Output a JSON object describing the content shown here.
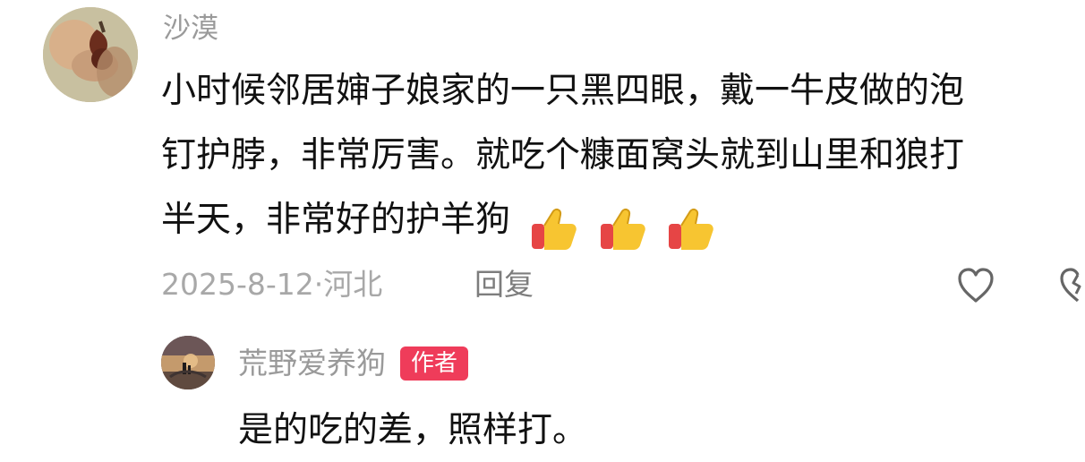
{
  "comment": {
    "username": "沙漠",
    "text_lines": [
      "小时候邻居婶子娘家的一只黑四眼，戴一牛皮做的泡",
      "钉护脖，非常厉害。就吃个糠面窝头就到山里和狼打",
      "半天，非常好的护羊狗"
    ],
    "emoji": [
      "thumbs-up-emoji",
      "thumbs-up-emoji",
      "thumbs-up-emoji"
    ],
    "meta": {
      "date_location": "2025-8-12·河北",
      "reply_label": "回复"
    },
    "icons": {
      "like": "heart-outline-icon",
      "dislike": "heart-broken-partial-icon"
    },
    "colors": {
      "username": "#9a9a9a",
      "text": "#111111",
      "meta": "#a8a8a8"
    }
  },
  "reply": {
    "username": "荒野爱养狗",
    "badge": "作者",
    "text": "是的吃的差，照样打。",
    "colors": {
      "badge_bg": "#ef3c5a",
      "badge_text": "#ffffff"
    }
  }
}
